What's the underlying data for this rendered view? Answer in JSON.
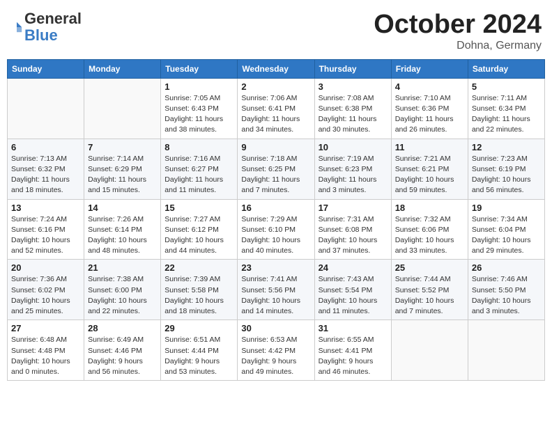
{
  "header": {
    "logo_general": "General",
    "logo_blue": "Blue",
    "month_title": "October 2024",
    "location": "Dohna, Germany"
  },
  "weekdays": [
    "Sunday",
    "Monday",
    "Tuesday",
    "Wednesday",
    "Thursday",
    "Friday",
    "Saturday"
  ],
  "weeks": [
    [
      {
        "day": "",
        "sunrise": "",
        "sunset": "",
        "daylight": ""
      },
      {
        "day": "",
        "sunrise": "",
        "sunset": "",
        "daylight": ""
      },
      {
        "day": "1",
        "sunrise": "Sunrise: 7:05 AM",
        "sunset": "Sunset: 6:43 PM",
        "daylight": "Daylight: 11 hours and 38 minutes."
      },
      {
        "day": "2",
        "sunrise": "Sunrise: 7:06 AM",
        "sunset": "Sunset: 6:41 PM",
        "daylight": "Daylight: 11 hours and 34 minutes."
      },
      {
        "day": "3",
        "sunrise": "Sunrise: 7:08 AM",
        "sunset": "Sunset: 6:38 PM",
        "daylight": "Daylight: 11 hours and 30 minutes."
      },
      {
        "day": "4",
        "sunrise": "Sunrise: 7:10 AM",
        "sunset": "Sunset: 6:36 PM",
        "daylight": "Daylight: 11 hours and 26 minutes."
      },
      {
        "day": "5",
        "sunrise": "Sunrise: 7:11 AM",
        "sunset": "Sunset: 6:34 PM",
        "daylight": "Daylight: 11 hours and 22 minutes."
      }
    ],
    [
      {
        "day": "6",
        "sunrise": "Sunrise: 7:13 AM",
        "sunset": "Sunset: 6:32 PM",
        "daylight": "Daylight: 11 hours and 18 minutes."
      },
      {
        "day": "7",
        "sunrise": "Sunrise: 7:14 AM",
        "sunset": "Sunset: 6:29 PM",
        "daylight": "Daylight: 11 hours and 15 minutes."
      },
      {
        "day": "8",
        "sunrise": "Sunrise: 7:16 AM",
        "sunset": "Sunset: 6:27 PM",
        "daylight": "Daylight: 11 hours and 11 minutes."
      },
      {
        "day": "9",
        "sunrise": "Sunrise: 7:18 AM",
        "sunset": "Sunset: 6:25 PM",
        "daylight": "Daylight: 11 hours and 7 minutes."
      },
      {
        "day": "10",
        "sunrise": "Sunrise: 7:19 AM",
        "sunset": "Sunset: 6:23 PM",
        "daylight": "Daylight: 11 hours and 3 minutes."
      },
      {
        "day": "11",
        "sunrise": "Sunrise: 7:21 AM",
        "sunset": "Sunset: 6:21 PM",
        "daylight": "Daylight: 10 hours and 59 minutes."
      },
      {
        "day": "12",
        "sunrise": "Sunrise: 7:23 AM",
        "sunset": "Sunset: 6:19 PM",
        "daylight": "Daylight: 10 hours and 56 minutes."
      }
    ],
    [
      {
        "day": "13",
        "sunrise": "Sunrise: 7:24 AM",
        "sunset": "Sunset: 6:16 PM",
        "daylight": "Daylight: 10 hours and 52 minutes."
      },
      {
        "day": "14",
        "sunrise": "Sunrise: 7:26 AM",
        "sunset": "Sunset: 6:14 PM",
        "daylight": "Daylight: 10 hours and 48 minutes."
      },
      {
        "day": "15",
        "sunrise": "Sunrise: 7:27 AM",
        "sunset": "Sunset: 6:12 PM",
        "daylight": "Daylight: 10 hours and 44 minutes."
      },
      {
        "day": "16",
        "sunrise": "Sunrise: 7:29 AM",
        "sunset": "Sunset: 6:10 PM",
        "daylight": "Daylight: 10 hours and 40 minutes."
      },
      {
        "day": "17",
        "sunrise": "Sunrise: 7:31 AM",
        "sunset": "Sunset: 6:08 PM",
        "daylight": "Daylight: 10 hours and 37 minutes."
      },
      {
        "day": "18",
        "sunrise": "Sunrise: 7:32 AM",
        "sunset": "Sunset: 6:06 PM",
        "daylight": "Daylight: 10 hours and 33 minutes."
      },
      {
        "day": "19",
        "sunrise": "Sunrise: 7:34 AM",
        "sunset": "Sunset: 6:04 PM",
        "daylight": "Daylight: 10 hours and 29 minutes."
      }
    ],
    [
      {
        "day": "20",
        "sunrise": "Sunrise: 7:36 AM",
        "sunset": "Sunset: 6:02 PM",
        "daylight": "Daylight: 10 hours and 25 minutes."
      },
      {
        "day": "21",
        "sunrise": "Sunrise: 7:38 AM",
        "sunset": "Sunset: 6:00 PM",
        "daylight": "Daylight: 10 hours and 22 minutes."
      },
      {
        "day": "22",
        "sunrise": "Sunrise: 7:39 AM",
        "sunset": "Sunset: 5:58 PM",
        "daylight": "Daylight: 10 hours and 18 minutes."
      },
      {
        "day": "23",
        "sunrise": "Sunrise: 7:41 AM",
        "sunset": "Sunset: 5:56 PM",
        "daylight": "Daylight: 10 hours and 14 minutes."
      },
      {
        "day": "24",
        "sunrise": "Sunrise: 7:43 AM",
        "sunset": "Sunset: 5:54 PM",
        "daylight": "Daylight: 10 hours and 11 minutes."
      },
      {
        "day": "25",
        "sunrise": "Sunrise: 7:44 AM",
        "sunset": "Sunset: 5:52 PM",
        "daylight": "Daylight: 10 hours and 7 minutes."
      },
      {
        "day": "26",
        "sunrise": "Sunrise: 7:46 AM",
        "sunset": "Sunset: 5:50 PM",
        "daylight": "Daylight: 10 hours and 3 minutes."
      }
    ],
    [
      {
        "day": "27",
        "sunrise": "Sunrise: 6:48 AM",
        "sunset": "Sunset: 4:48 PM",
        "daylight": "Daylight: 10 hours and 0 minutes."
      },
      {
        "day": "28",
        "sunrise": "Sunrise: 6:49 AM",
        "sunset": "Sunset: 4:46 PM",
        "daylight": "Daylight: 9 hours and 56 minutes."
      },
      {
        "day": "29",
        "sunrise": "Sunrise: 6:51 AM",
        "sunset": "Sunset: 4:44 PM",
        "daylight": "Daylight: 9 hours and 53 minutes."
      },
      {
        "day": "30",
        "sunrise": "Sunrise: 6:53 AM",
        "sunset": "Sunset: 4:42 PM",
        "daylight": "Daylight: 9 hours and 49 minutes."
      },
      {
        "day": "31",
        "sunrise": "Sunrise: 6:55 AM",
        "sunset": "Sunset: 4:41 PM",
        "daylight": "Daylight: 9 hours and 46 minutes."
      },
      {
        "day": "",
        "sunrise": "",
        "sunset": "",
        "daylight": ""
      },
      {
        "day": "",
        "sunrise": "",
        "sunset": "",
        "daylight": ""
      }
    ]
  ]
}
